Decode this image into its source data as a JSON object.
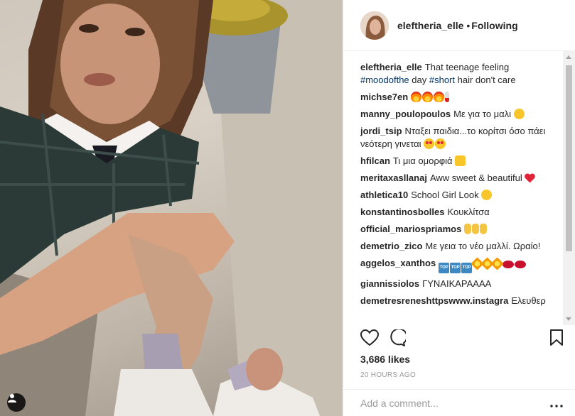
{
  "post": {
    "username": "eleftheria_elle",
    "separator": "•",
    "follow_status": "Following"
  },
  "caption": {
    "username": "eleftheria_elle",
    "text_1": "That teenage feeling",
    "tag_1": "#moodofthe",
    "text_2": " day ",
    "tag_2": "#short",
    "text_3": " hair don't care"
  },
  "comments": [
    {
      "user": "michse7en",
      "text": "",
      "emoji": [
        "fire",
        "fire",
        "fire",
        "thermo"
      ]
    },
    {
      "user": "manny_poulopoulos",
      "text": "Με για το μαλι",
      "emoji": [
        "smile"
      ]
    },
    {
      "user": "jordi_tsip",
      "text": "Νταξει παιδια...το κορίτσι όσο πάει νεότερη γινεται",
      "emoji": [
        "heart-eyes",
        "heart-eyes"
      ]
    },
    {
      "user": "hfilcan",
      "text": "Τι μια ομορφιά",
      "emoji": [
        "thumb"
      ]
    },
    {
      "user": "meritaxasllanaj",
      "text": "Aww sweet & beautiful",
      "emoji": [
        "heart"
      ]
    },
    {
      "user": "athletica10",
      "text": "School Girl Look",
      "emoji": [
        "smile"
      ]
    },
    {
      "user": "konstantinosbolles",
      "text": "Κουκλίτσα",
      "emoji": []
    },
    {
      "user": "official_mariospriamos",
      "text": "",
      "emoji": [
        "victory",
        "victory",
        "victory"
      ]
    },
    {
      "user": "demetrio_zico",
      "text": "Με γεια το νέο μαλλί. Ωραίο!",
      "emoji": []
    },
    {
      "user": "aggelos_xanthos",
      "text": "",
      "emoji": [
        "top",
        "top",
        "top",
        "burst",
        "burst",
        "burst",
        "lips",
        "lips"
      ]
    },
    {
      "user": "giannissiolos",
      "text": "ΓΥΝΑΙΚΑΡΑΑΑΑ",
      "emoji": []
    },
    {
      "user": "demetresreneshttpswww.instagra",
      "text": "Ελευθερ",
      "emoji": []
    }
  ],
  "emoji_labels": {
    "top": "TOP"
  },
  "stats": {
    "likes": "3,686 likes",
    "timestamp": "20 HOURS AGO"
  },
  "add_comment": {
    "placeholder": "Add a comment..."
  },
  "colors": {
    "hashtag": "#003569",
    "text": "#262626",
    "muted": "#999999",
    "border": "#efefef"
  },
  "icons": [
    "user-tag-icon",
    "heart-icon",
    "comment-icon",
    "bookmark-icon",
    "more-options-icon"
  ]
}
